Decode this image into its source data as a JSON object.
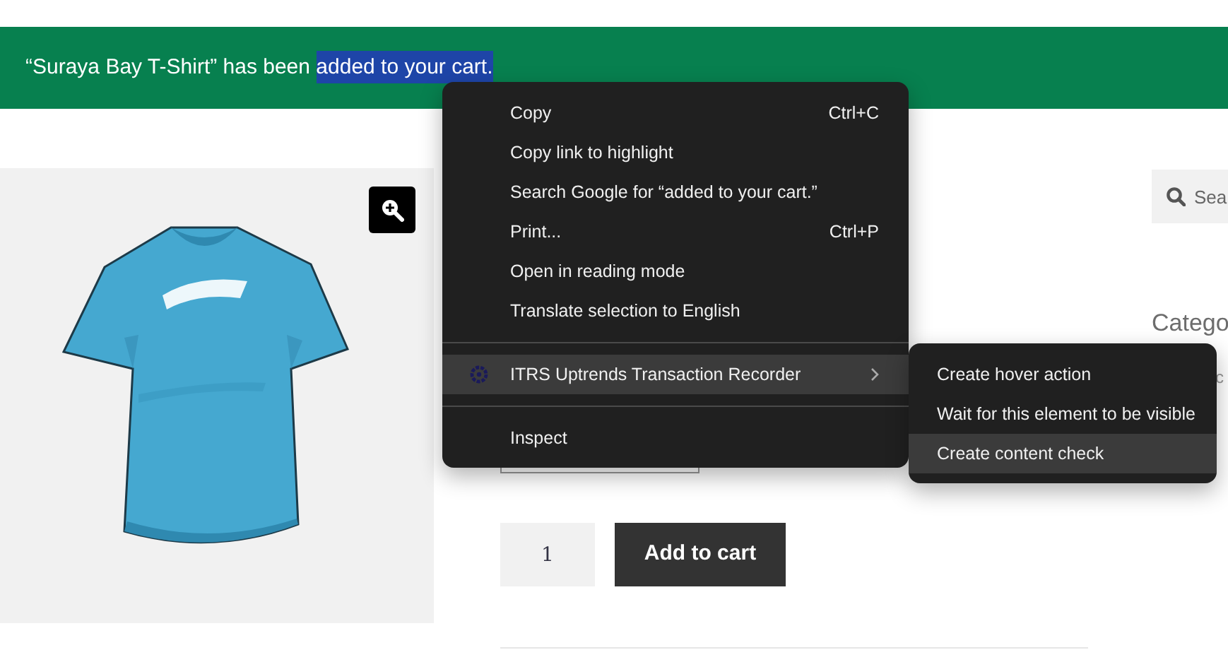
{
  "notice": {
    "text": "“Suraya Bay T-Shirt” has been ",
    "selected_text": "added to your cart."
  },
  "search": {
    "placeholder": "Sea"
  },
  "sidebar": {
    "heading": "Catego",
    "partial_link": "c"
  },
  "quantity": {
    "value": "1"
  },
  "add_to_cart": "Add to cart",
  "context_menu": {
    "items": [
      {
        "kind": "item",
        "label": "Copy",
        "shortcut": "Ctrl+C",
        "selected": false
      },
      {
        "kind": "item",
        "label": "Copy link to highlight",
        "selected": false
      },
      {
        "kind": "item",
        "label": "Search Google for “added to your cart.”",
        "selected": false
      },
      {
        "kind": "item",
        "label": "Print...",
        "shortcut": "Ctrl+P",
        "selected": false
      },
      {
        "kind": "item",
        "label": "Open in reading mode",
        "selected": false
      },
      {
        "kind": "item",
        "label": "Translate selection to English",
        "selected": false
      },
      {
        "kind": "separator"
      },
      {
        "kind": "submenu",
        "label": "ITRS Uptrends Transaction Recorder",
        "selected": true
      },
      {
        "kind": "separator"
      },
      {
        "kind": "item",
        "label": "Inspect",
        "selected": false
      }
    ]
  },
  "submenu": {
    "items": [
      {
        "label": "Create hover action",
        "selected": false
      },
      {
        "label": "Wait for this element to be visible",
        "selected": false
      },
      {
        "label": "Create content check",
        "selected": true
      }
    ]
  }
}
